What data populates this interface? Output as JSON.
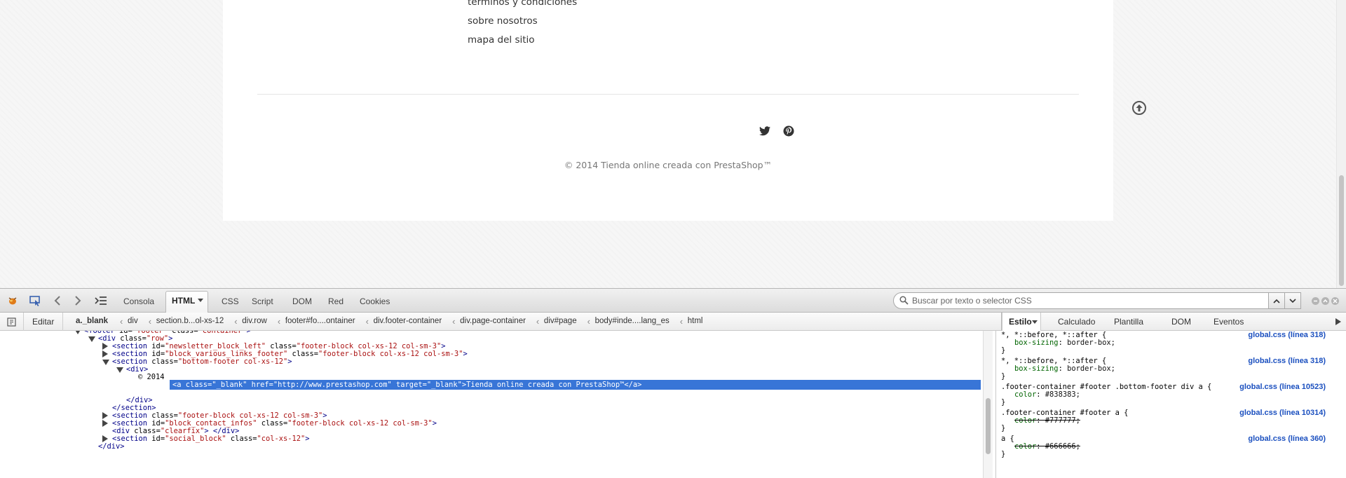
{
  "footer": {
    "links": [
      "términos y condiciones",
      "sobre nosotros",
      "mapa del sitio"
    ],
    "social_icons": [
      "twitter-icon",
      "pinterest-icon"
    ],
    "copyright": "© 2014 Tienda online creada con PrestaShop™"
  },
  "devtools": {
    "tabs": [
      "Consola",
      "HTML",
      "CSS",
      "Script",
      "DOM",
      "Red",
      "Cookies"
    ],
    "active_tab": "HTML",
    "search_placeholder": "Buscar por texto o selector CSS",
    "edit_label": "Editar",
    "breadcrumbs": [
      "a._blank",
      "div",
      "section.b...ol-xs-12",
      "div.row",
      "footer#fo....ontainer",
      "div.footer-container",
      "div.page-container",
      "div#page",
      "body#inde....lang_es",
      "html"
    ],
    "html_lines": [
      {
        "tag_open": "<footer",
        "attrs": [
          [
            "id",
            "footer"
          ],
          [
            "class",
            "container"
          ]
        ],
        "tag_close": ">"
      },
      {
        "tag_open": "<div",
        "attrs": [
          [
            "class",
            "row"
          ]
        ],
        "tag_close": ">"
      },
      {
        "tag_open": "<section",
        "attrs": [
          [
            "id",
            "newsletter_block_left"
          ],
          [
            "class",
            "footer-block col-xs-12 col-sm-3"
          ]
        ],
        "tag_close": ">"
      },
      {
        "tag_open": "<section",
        "attrs": [
          [
            "id",
            "block_various_links_footer"
          ],
          [
            "class",
            "footer-block col-xs-12 col-sm-3"
          ]
        ],
        "tag_close": ">"
      },
      {
        "tag_open": "<section",
        "attrs": [
          [
            "class",
            "bottom-footer col-xs-12"
          ]
        ],
        "tag_close": ">"
      },
      {
        "tag_open": "<div>",
        "attrs": [],
        "tag_close": ""
      },
      {
        "text": "© 2014"
      },
      {
        "selected": "<a class=\"_blank\" href=\"http://www.prestashop.com\" target=\"_blank\">Tienda online creada con PrestaShop™</a>"
      },
      {
        "tag_open": "</div>",
        "attrs": [],
        "tag_close": ""
      },
      {
        "tag_open": "</section>",
        "attrs": [],
        "tag_close": ""
      },
      {
        "tag_open": "<section",
        "attrs": [
          [
            "class",
            "footer-block col-xs-12 col-sm-3"
          ]
        ],
        "tag_close": ">"
      },
      {
        "tag_open": "<section",
        "attrs": [
          [
            "id",
            "block_contact_infos"
          ],
          [
            "class",
            "footer-block col-xs-12 col-sm-3"
          ]
        ],
        "tag_close": ">"
      },
      {
        "tag_open": "<div",
        "attrs": [
          [
            "class",
            "clearfix"
          ]
        ],
        "tag_close": "> </div>"
      },
      {
        "tag_open": "<section",
        "attrs": [
          [
            "id",
            "social_block"
          ],
          [
            "class",
            "col-xs-12"
          ]
        ],
        "tag_close": ">"
      },
      {
        "tag_open": "</div>",
        "attrs": [],
        "tag_close": ""
      }
    ],
    "side_tabs": [
      "Estilo",
      "Calculado",
      "Plantilla",
      "DOM",
      "Eventos"
    ],
    "active_side_tab": "Estilo",
    "style_rules": [
      {
        "selector": "*, *::before, *::after {",
        "source": "global.css (línea 318)",
        "decls": [
          {
            "prop": "box-sizing",
            "value": "border-box;",
            "struck": false
          }
        ]
      },
      {
        "selector": "*, *::before, *::after {",
        "source": "global.css (línea 318)",
        "decls": [
          {
            "prop": "box-sizing",
            "value": "border-box;",
            "struck": false
          }
        ]
      },
      {
        "selector": ".footer-container #footer .bottom-footer div a {",
        "source": "global.css (línea 10523)",
        "decls": [
          {
            "prop": "color",
            "value": "#838383;",
            "struck": false
          }
        ]
      },
      {
        "selector": ".footer-container #footer a {",
        "source": "global.css (línea 10314)",
        "decls": [
          {
            "prop": "color",
            "value": "#777777;",
            "struck": true
          }
        ]
      },
      {
        "selector": "a {",
        "source": "global.css (línea 360)",
        "decls": [
          {
            "prop": "color",
            "value": "#666666;",
            "struck": true
          }
        ]
      }
    ]
  }
}
